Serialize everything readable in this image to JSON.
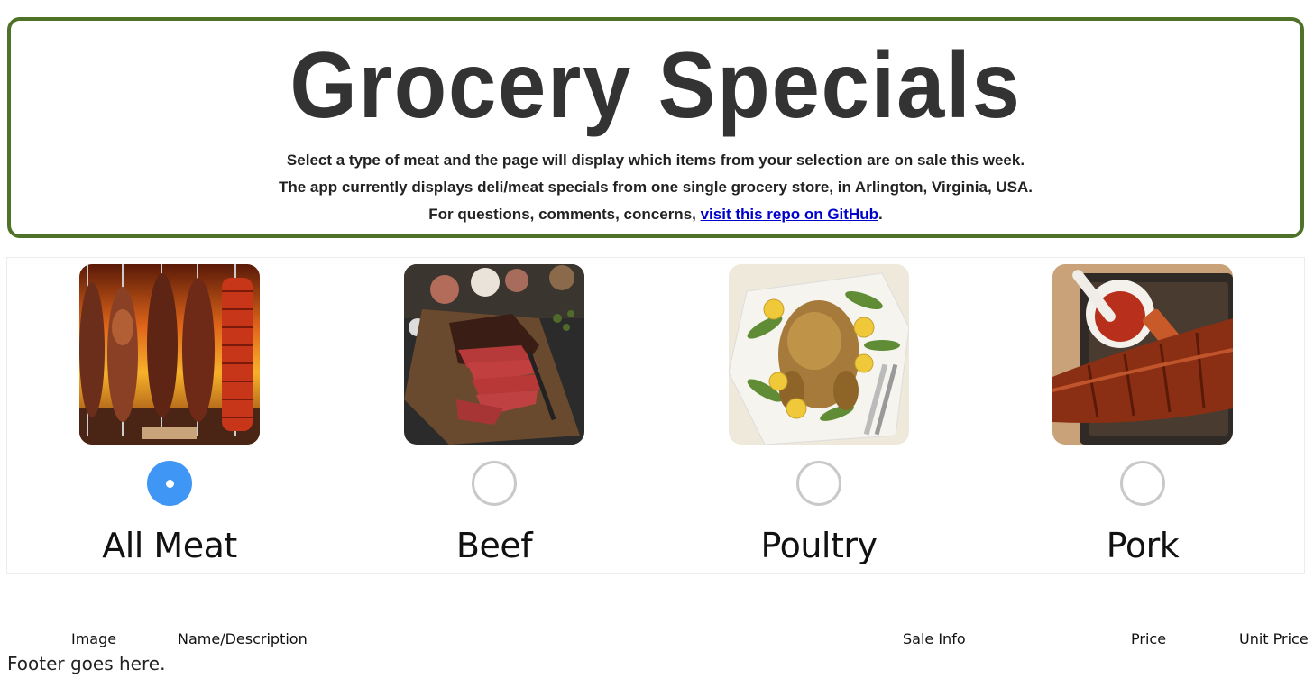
{
  "header": {
    "title": "Grocery Specials",
    "line1": "Select a type of meat and the page will display which items from your selection are on sale this week.",
    "line2": "The app currently displays deli/meat specials from one single grocery store, in Arlington, Virginia, USA.",
    "line3_prefix": "For questions, comments, concerns, ",
    "line3_link": "visit this repo on GitHub",
    "line3_suffix": ".",
    "border_color": "#4e7227"
  },
  "meat_options": [
    {
      "label": "All Meat",
      "image": "grilled-skewers-photo",
      "selected": true
    },
    {
      "label": "Beef",
      "image": "sliced-beef-roast-photo",
      "selected": false
    },
    {
      "label": "Poultry",
      "image": "roast-chicken-photo",
      "selected": false
    },
    {
      "label": "Pork",
      "image": "bbq-pork-ribs-photo",
      "selected": false
    }
  ],
  "radio_selected_color": "#3f96f4",
  "table": {
    "columns": [
      "Image",
      "Name/Description",
      "Sale Info",
      "Price",
      "Unit Price"
    ]
  },
  "footer": {
    "text": "Footer goes here."
  }
}
